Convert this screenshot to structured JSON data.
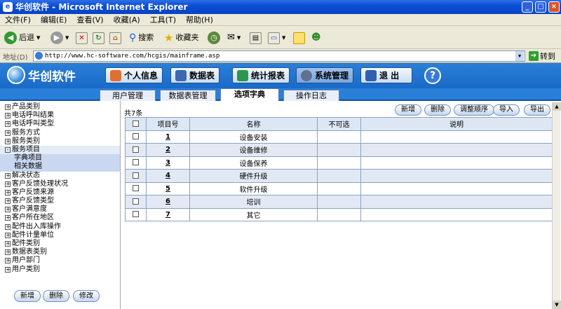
{
  "window": {
    "title": "华创软件 - Microsoft Internet Explorer",
    "icon": "ie-icon",
    "controls": [
      "_",
      "□",
      "×"
    ]
  },
  "menu": [
    "文件(F)",
    "编辑(E)",
    "查看(V)",
    "收藏(A)",
    "工具(T)",
    "帮助(H)"
  ],
  "toolbar": {
    "back": "后退",
    "search": "搜索",
    "favorites": "收藏夹"
  },
  "address": {
    "label": "地址(D)",
    "url": "http://www.hc-software.com/hcgis/mainframe.asp",
    "go": "转到"
  },
  "app": {
    "logo": "华创软件",
    "nav": [
      "个人信息",
      "数据表",
      "统计报表",
      "系统管理",
      "退 出"
    ],
    "help": "?"
  },
  "tabs": [
    "用户管理",
    "数据表管理",
    "选项字典",
    "操作日志"
  ],
  "sidebar": {
    "items": [
      "产品类别",
      "电话呼叫结果",
      "电话呼叫类型",
      "服务方式",
      "服务类别",
      "服务项目",
      "字典项目",
      "相关数据",
      "解决状态",
      "客户反馈处理状况",
      "客户反馈来源",
      "客户反馈类型",
      "客户满意度",
      "客户所在地区",
      "配件出入库操作",
      "配件计量单位",
      "配件类别",
      "数据表类别",
      "用户部门",
      "用户类别"
    ],
    "buttons": [
      "新增",
      "删除",
      "修改"
    ]
  },
  "content": {
    "count": "共7条",
    "actions": [
      "新增",
      "删除",
      "调整顺序",
      "导入",
      "导出"
    ],
    "columns": [
      "项目号",
      "名称",
      "不可选",
      "说明"
    ],
    "rows": [
      {
        "id": "1",
        "name": "设备安装"
      },
      {
        "id": "2",
        "name": "设备维修"
      },
      {
        "id": "3",
        "name": "设备保养"
      },
      {
        "id": "4",
        "name": "硬件升级"
      },
      {
        "id": "5",
        "name": "软件升级"
      },
      {
        "id": "6",
        "name": "培训"
      },
      {
        "id": "7",
        "name": "其它"
      }
    ]
  }
}
